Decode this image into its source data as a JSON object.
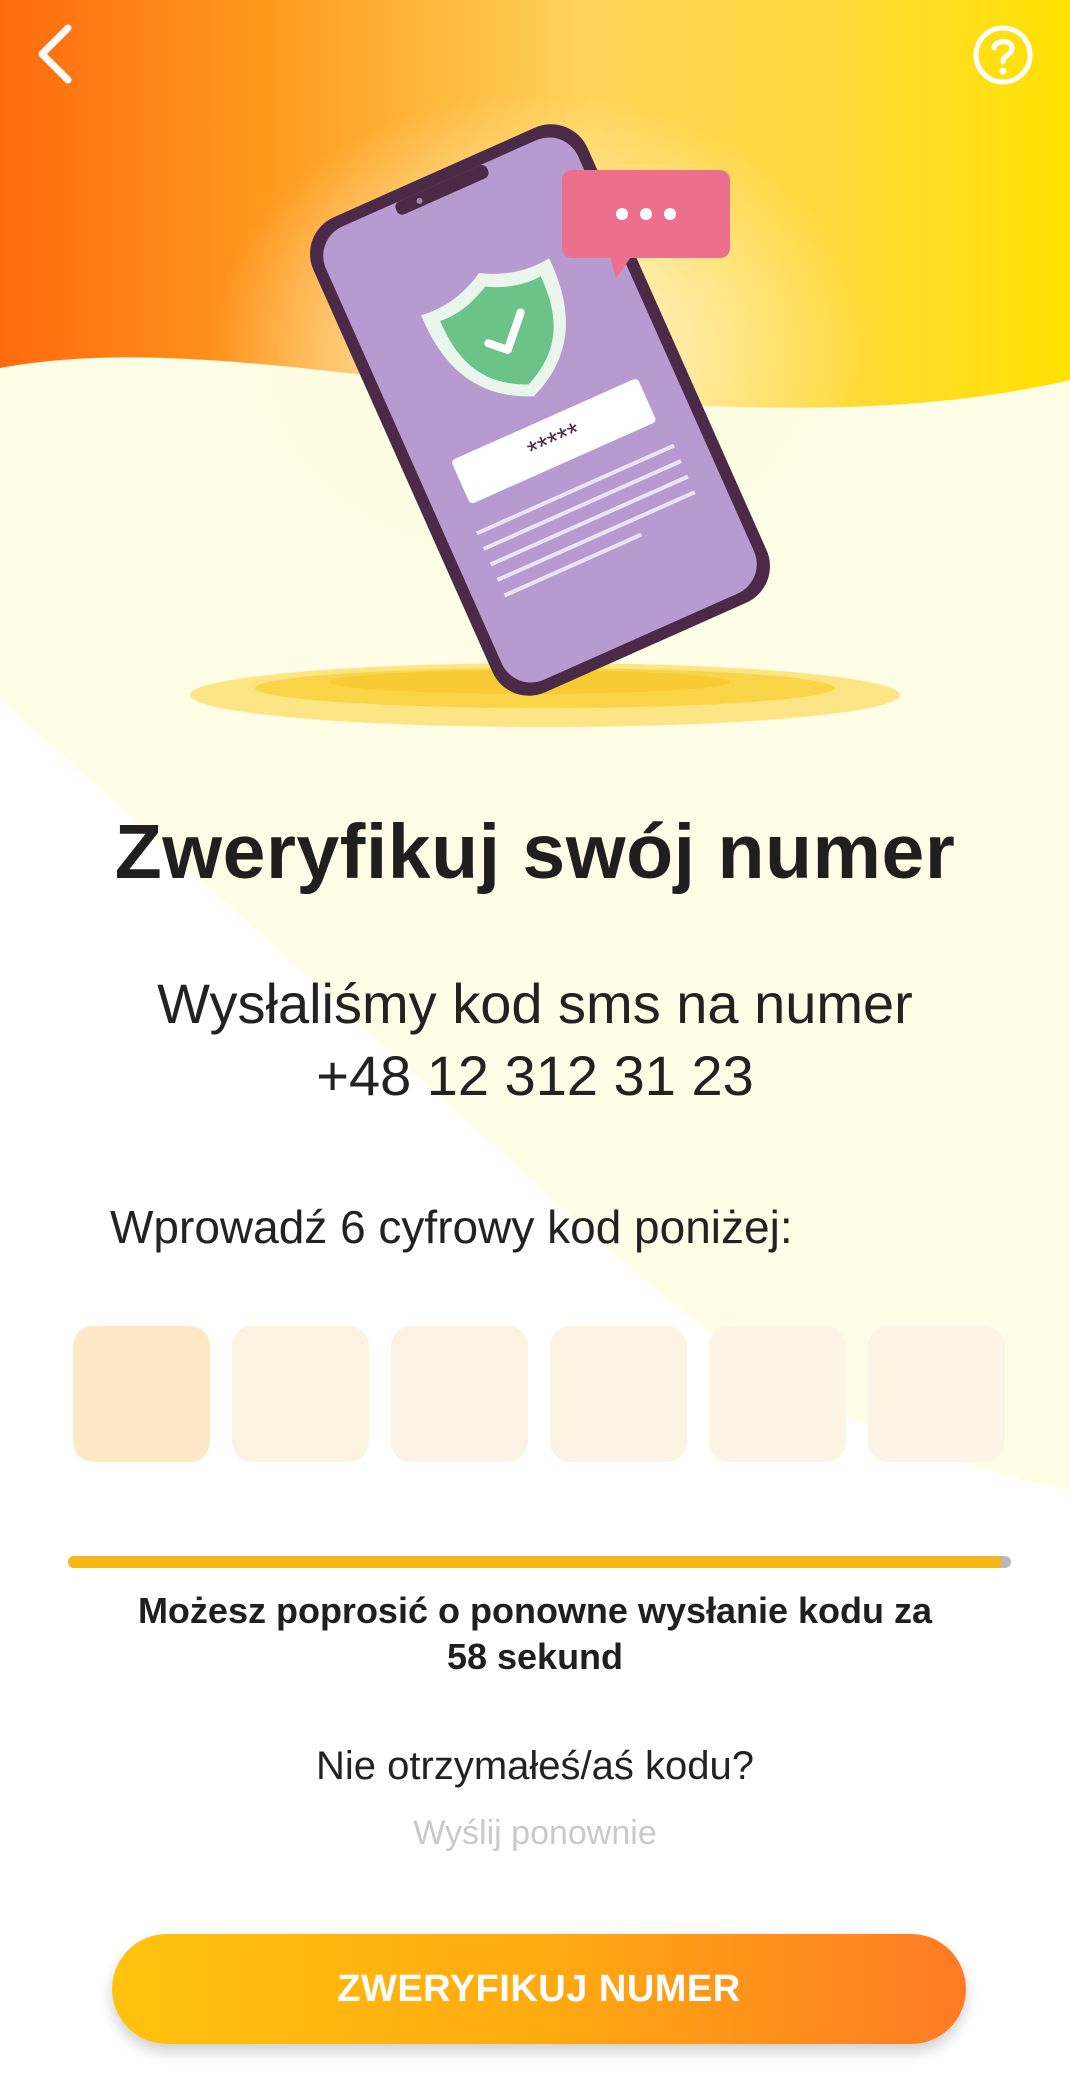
{
  "header": {
    "back_icon": "chevron-left-icon",
    "help_icon": "question-circle-icon"
  },
  "hero": {
    "illustration": "phone-shield-verification-illustration",
    "masked_code": "*****"
  },
  "title": "Zweryfikuj swój numer",
  "subtitle": {
    "line1": "Wysłaliśmy kod sms na numer",
    "phone": "+48 12 312 31 23"
  },
  "code_entry": {
    "label": "Wprowadź 6 cyfrowy kod poniżej:",
    "digits": [
      "",
      "",
      "",
      "",
      "",
      ""
    ]
  },
  "timer": {
    "progress": 0.99,
    "message_line1": "Możesz poprosić o ponowne wysłanie kodu za",
    "message_line2": "58 sekund"
  },
  "resend": {
    "question": "Nie otrzymałeś/aś kodu?",
    "link": "Wyślij ponownie"
  },
  "verify_button": {
    "label": "ZWERYFIKUJ NUMER"
  },
  "colors": {
    "accent_orange": "#ff7a25",
    "accent_yellow": "#ffc20e",
    "progress": "#f8b617",
    "code_box": "#fdf1dc"
  }
}
